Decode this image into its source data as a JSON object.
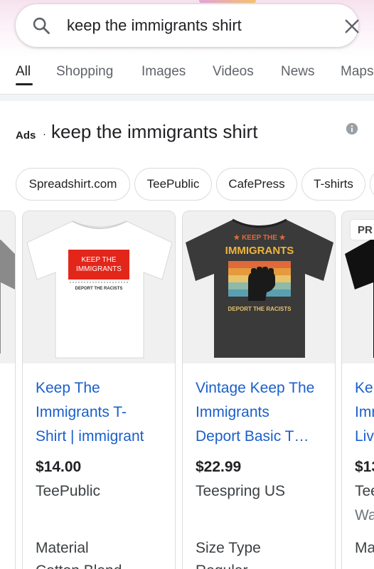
{
  "search": {
    "query": "keep the immigrants shirt"
  },
  "tabs": [
    {
      "label": "All"
    },
    {
      "label": "Shopping"
    },
    {
      "label": "Images"
    },
    {
      "label": "Videos"
    },
    {
      "label": "News"
    },
    {
      "label": "Maps"
    }
  ],
  "ads": {
    "label": "Ads",
    "separator": "·",
    "title": "keep the immigrants shirt"
  },
  "chips": [
    {
      "label": "Spreadshirt.com"
    },
    {
      "label": "TeePublic"
    },
    {
      "label": "CafePress"
    },
    {
      "label": "T-shirts"
    }
  ],
  "products": [
    {
      "title_lines": [
        "Keep The",
        "Immigrants T-",
        "Shirt | immigrant"
      ],
      "price": "$14.00",
      "store": "TeePublic",
      "extra": "Material",
      "extra2": "Cotton Blend",
      "shirt_color": "#f4f4f4",
      "print_line1": "KEEP THE",
      "print_line2": "IMMIGRANTS",
      "print_line3": "DEPORT THE RACISTS"
    },
    {
      "title_lines": [
        "Vintage Keep The",
        "Immigrants",
        "Deport Basic T…"
      ],
      "price": "$22.99",
      "store": "Teespring US",
      "extra": "Size Type",
      "extra2": "Regular",
      "shirt_color": "#3a3a3a",
      "print_line1": "★ KEEP THE ★",
      "print_line2": "IMMIGRANTS",
      "print_line3": "DEPORT THE RACISTS"
    },
    {
      "badge": "PR",
      "title_lines": [
        "Ke",
        "Imr",
        "Liv"
      ],
      "price": "$13",
      "store": "Tee",
      "store2": "Wa",
      "extra": "Ma",
      "shirt_color": "#111111"
    }
  ]
}
